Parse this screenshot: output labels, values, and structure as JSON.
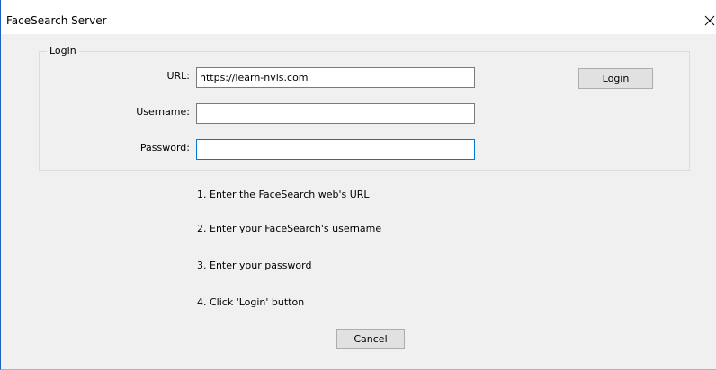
{
  "window": {
    "title": "FaceSearch Server",
    "close_icon": "close-icon"
  },
  "login_group": {
    "label": "Login",
    "url_label": "URL:",
    "url_value": "https://learn-nvls.com",
    "username_label": "Username:",
    "username_value": "",
    "password_label": "Password:",
    "password_value": "",
    "login_button": "Login"
  },
  "instructions": [
    "1.  Enter the FaceSearch web's URL",
    "2.  Enter your FaceSearch's username",
    "3.  Enter your password",
    "4.  Click 'Login' button"
  ],
  "cancel_button": "Cancel",
  "colors": {
    "focus_border": "#0078d7",
    "window_border": "#1c62b9",
    "dialog_background": "#f0f0f0"
  }
}
